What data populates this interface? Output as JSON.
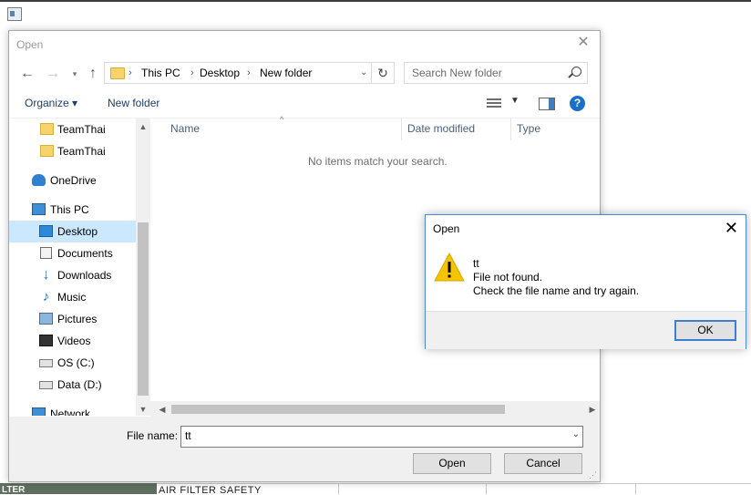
{
  "dialog": {
    "title": "Open",
    "breadcrumb": [
      "This PC",
      "Desktop",
      "New folder"
    ],
    "search_placeholder": "Search New folder",
    "toolbar": {
      "organize": "Organize ▾",
      "new_folder": "New folder",
      "help": "?"
    },
    "nav_items": [
      {
        "label": "TeamThai",
        "icon": "folder-icon"
      },
      {
        "label": "TeamThai",
        "icon": "folder-icon"
      },
      {
        "label": "OneDrive",
        "icon": "onedrive-icon"
      },
      {
        "label": "This PC",
        "icon": "pc-icon"
      },
      {
        "label": "Desktop",
        "icon": "desktop-icon",
        "selected": true
      },
      {
        "label": "Documents",
        "icon": "documents-icon"
      },
      {
        "label": "Downloads",
        "icon": "downloads-icon"
      },
      {
        "label": "Music",
        "icon": "music-icon"
      },
      {
        "label": "Pictures",
        "icon": "pictures-icon"
      },
      {
        "label": "Videos",
        "icon": "videos-icon"
      },
      {
        "label": "OS (C:)",
        "icon": "drive-icon"
      },
      {
        "label": "Data (D:)",
        "icon": "drive-icon"
      },
      {
        "label": "Network",
        "icon": "network-icon"
      }
    ],
    "columns": [
      "Name",
      "Date modified",
      "Type"
    ],
    "empty_message": "No items match your search.",
    "file_name_label": "File name:",
    "file_name_value": "tt",
    "open_button": "Open",
    "cancel_button": "Cancel"
  },
  "message_box": {
    "title": "Open",
    "lines": [
      "tt",
      "File not found.",
      "Check the file name and try again."
    ],
    "ok_button": "OK",
    "icon": "warning-icon"
  },
  "background": {
    "bottom_left_text": "LTER",
    "bottom_text": "AIR FILTER SAFETY"
  },
  "colors": {
    "accent": "#1a6fc9",
    "selection": "#cce8ff",
    "warning": "#f5c400"
  }
}
